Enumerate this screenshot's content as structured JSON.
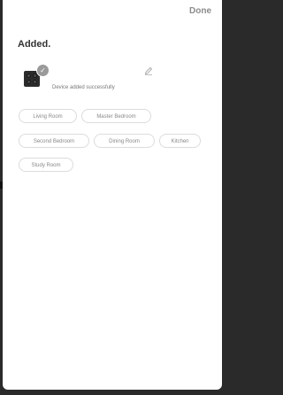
{
  "header": {
    "done_label": "Done"
  },
  "title": "Added.",
  "device": {
    "status": "Device added successfully",
    "icon": "cooktop-icon"
  },
  "rooms": [
    "Living Room",
    "Master Bedroom",
    "Second Bedroom",
    "Dining Room",
    "Kitchen",
    "Study Room"
  ],
  "colors": {
    "chip_border": "#dcdcdc",
    "chip_text": "#888888",
    "badge": "#9a9a9a"
  }
}
